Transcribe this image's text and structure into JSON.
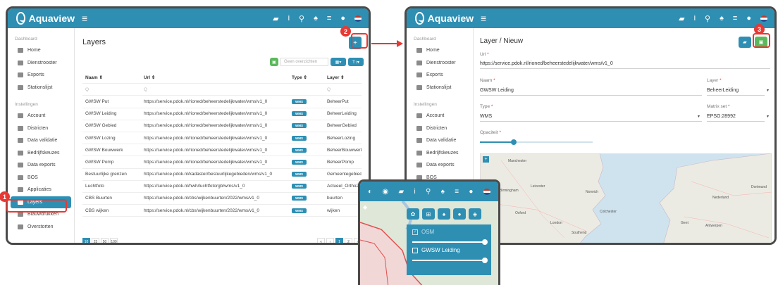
{
  "app": {
    "name": "Aquaview"
  },
  "left": {
    "sidebar": {
      "sections": [
        {
          "title": "Dashboard",
          "items": [
            "Home",
            "Dienstrooster",
            "Exports",
            "Stationslijst"
          ]
        },
        {
          "title": "Instellingen",
          "items": [
            "Account",
            "Districten",
            "Data validatie",
            "Bedrijfskeuzes",
            "Data exports",
            "BOS",
            "Applicaties",
            "Layers",
            "Blauwdrukken",
            "Overstorten"
          ]
        }
      ]
    },
    "page_title": "Layers",
    "filter_placeholder": "Geen overzichten",
    "columns": [
      "Naam ⇕",
      "Url ⇕",
      "Type ⇕",
      "Layer ⇕"
    ],
    "search_glyph": "Q",
    "rows": [
      {
        "naam": "GWSW Put",
        "url": "https://service.pdok.nl/rioned/beheerstedelijkwater/wms/v1_0",
        "type": "WMS",
        "layer": "BeheerPut"
      },
      {
        "naam": "GWSW Leiding",
        "url": "https://service.pdok.nl/rioned/beheerstedelijkwater/wms/v1_0",
        "type": "WMS",
        "layer": "BeheerLeiding"
      },
      {
        "naam": "GWSW Gebied",
        "url": "https://service.pdok.nl/rioned/beheerstedelijkwater/wms/v1_0",
        "type": "WMS",
        "layer": "BeheerGebied"
      },
      {
        "naam": "GWSW Lozing",
        "url": "https://service.pdok.nl/rioned/beheerstedelijkwater/wms/v1_0",
        "type": "WMS",
        "layer": "BeheerLozing"
      },
      {
        "naam": "GWSW Bouwwerk",
        "url": "https://service.pdok.nl/rioned/beheerstedelijkwater/wms/v1_0",
        "type": "WMS",
        "layer": "BeheerBouwwerk"
      },
      {
        "naam": "GWSW Pomp",
        "url": "https://service.pdok.nl/rioned/beheerstedelijkwater/wms/v1_0",
        "type": "WMS",
        "layer": "BeheerPomp"
      },
      {
        "naam": "Bestuurlijke grenzen",
        "url": "https://service.pdok.nl/kadaster/bestuurlijkegebieden/wms/v1_0",
        "type": "WMS",
        "layer": "Gemeentegebied"
      },
      {
        "naam": "Luchtfoto",
        "url": "https://service.pdok.nl/hwh/luchtfotorgb/wms/v1_0",
        "type": "WMS",
        "layer": "Actueel_Ortho2"
      },
      {
        "naam": "CBS Buurten",
        "url": "https://service.pdok.nl/cbs/wijkenbuurten/2022/wms/v1_0",
        "type": "WMS",
        "layer": "buurten"
      },
      {
        "naam": "CBS wijken",
        "url": "https://service.pdok.nl/cbs/wijkenbuurten/2022/wms/v1_0",
        "type": "WMS",
        "layer": "wijken"
      }
    ],
    "page_sizes": [
      "10",
      "25",
      "50",
      "100"
    ],
    "pages": [
      "«",
      "‹",
      "1",
      "2",
      "›"
    ],
    "add_label": "+",
    "grid_btn_label": "▦▾",
    "text_btn_label": "T↕▾"
  },
  "right": {
    "sidebar": {
      "sections": [
        {
          "title": "Dashboard",
          "items": [
            "Home",
            "Dienstrooster",
            "Exports",
            "Stationslijst"
          ]
        },
        {
          "title": "Instellingen",
          "items": [
            "Account",
            "Districten",
            "Data validatie",
            "Bedrijfskeuzes",
            "Data exports",
            "BOS"
          ]
        }
      ]
    },
    "page_title": "Layer / Nieuw",
    "url_label": "Url",
    "url_value": "https://service.pdok.nl/rioned/beheerstedelijkwater/wms/v1_0",
    "naam_label": "Naam",
    "naam_value": "GWSW Leiding",
    "layer_label": "Layer",
    "layer_value": "BeheerLeiding",
    "type_label": "Type",
    "type_value": "WMS",
    "matrix_label": "Matrix set",
    "matrix_value": "EPSG:28992",
    "opacity_label": "Opaciteit",
    "opacity_value": 0.3,
    "req_mark": "*",
    "map_labels": [
      "Manchester",
      "Birmingham",
      "Leicester",
      "Norwich",
      "Nederland",
      "Oxford",
      "London",
      "Colchester",
      "Antwerpen",
      "Gent",
      "Dortmund",
      "Southend"
    ]
  },
  "popup": {
    "layers": [
      {
        "name": "OSM",
        "checked": true,
        "opacity": 1.0
      },
      {
        "name": "GWSW Leiding",
        "checked": false,
        "opacity": 1.0
      }
    ]
  },
  "callouts": [
    "1",
    "2",
    "3"
  ],
  "colors": {
    "primary": "#2e8fb3",
    "green": "#5cb85c",
    "red": "#e53935"
  }
}
